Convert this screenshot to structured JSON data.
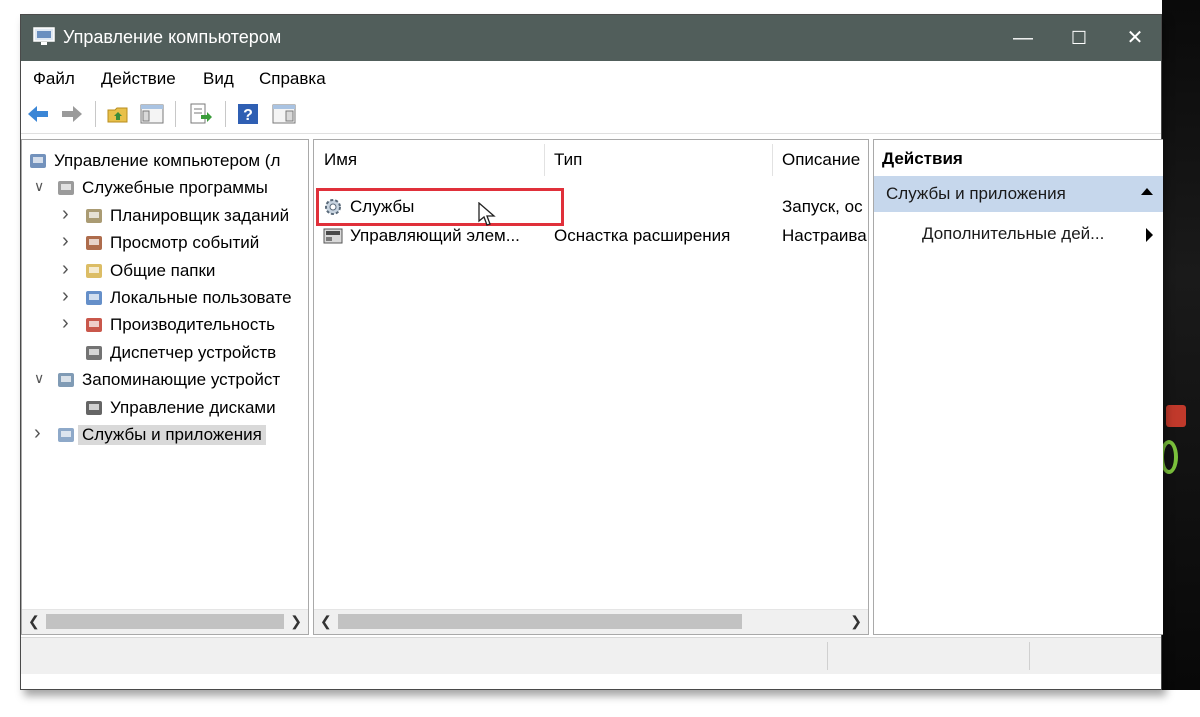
{
  "window": {
    "title": "Управление компьютером",
    "controls": {
      "minimize": "—",
      "maximize": "☐",
      "close": "✕"
    }
  },
  "menu": [
    "Файл",
    "Действие",
    "Вид",
    "Справка"
  ],
  "toolbar": [
    "back-icon",
    "forward-icon",
    "up-folder-icon",
    "show-hide-tree-icon",
    "export-list-icon",
    "help-icon",
    "show-hide-action-icon"
  ],
  "tree": [
    {
      "label": "Управление компьютером (л",
      "icon": "computer-management-icon",
      "level": 0,
      "expander": ""
    },
    {
      "label": "Служебные программы",
      "icon": "system-tools-icon",
      "level": 1,
      "expander": "expanded"
    },
    {
      "label": "Планировщик заданий",
      "icon": "task-scheduler-icon",
      "level": 2,
      "expander": "collapsed"
    },
    {
      "label": "Просмотр событий",
      "icon": "event-viewer-icon",
      "level": 2,
      "expander": "collapsed"
    },
    {
      "label": "Общие папки",
      "icon": "shared-folders-icon",
      "level": 2,
      "expander": "collapsed"
    },
    {
      "label": "Локальные пользовате",
      "icon": "local-users-icon",
      "level": 2,
      "expander": "collapsed"
    },
    {
      "label": "Производительность",
      "icon": "performance-icon",
      "level": 2,
      "expander": "collapsed"
    },
    {
      "label": "Диспетчер устройств",
      "icon": "device-manager-icon",
      "level": 2,
      "expander": ""
    },
    {
      "label": "Запоминающие устройст",
      "icon": "storage-icon",
      "level": 1,
      "expander": "expanded"
    },
    {
      "label": "Управление дисками",
      "icon": "disk-management-icon",
      "level": 2,
      "expander": ""
    },
    {
      "label": "Службы и приложения",
      "icon": "services-apps-icon",
      "level": 1,
      "expander": "collapsed",
      "selected": true
    }
  ],
  "list": {
    "columns": [
      "Имя",
      "Тип",
      "Описание"
    ],
    "rows": [
      {
        "name": "Службы",
        "type": "",
        "description": "Запуск, ос",
        "icon": "services-gear-icon"
      },
      {
        "name": "Управляющий элем...",
        "type": "Оснастка расширения",
        "description": "Настраива",
        "icon": "wmi-control-icon"
      }
    ]
  },
  "actions": {
    "header": "Действия",
    "group": "Службы и приложения",
    "item": "Дополнительные дей..."
  }
}
